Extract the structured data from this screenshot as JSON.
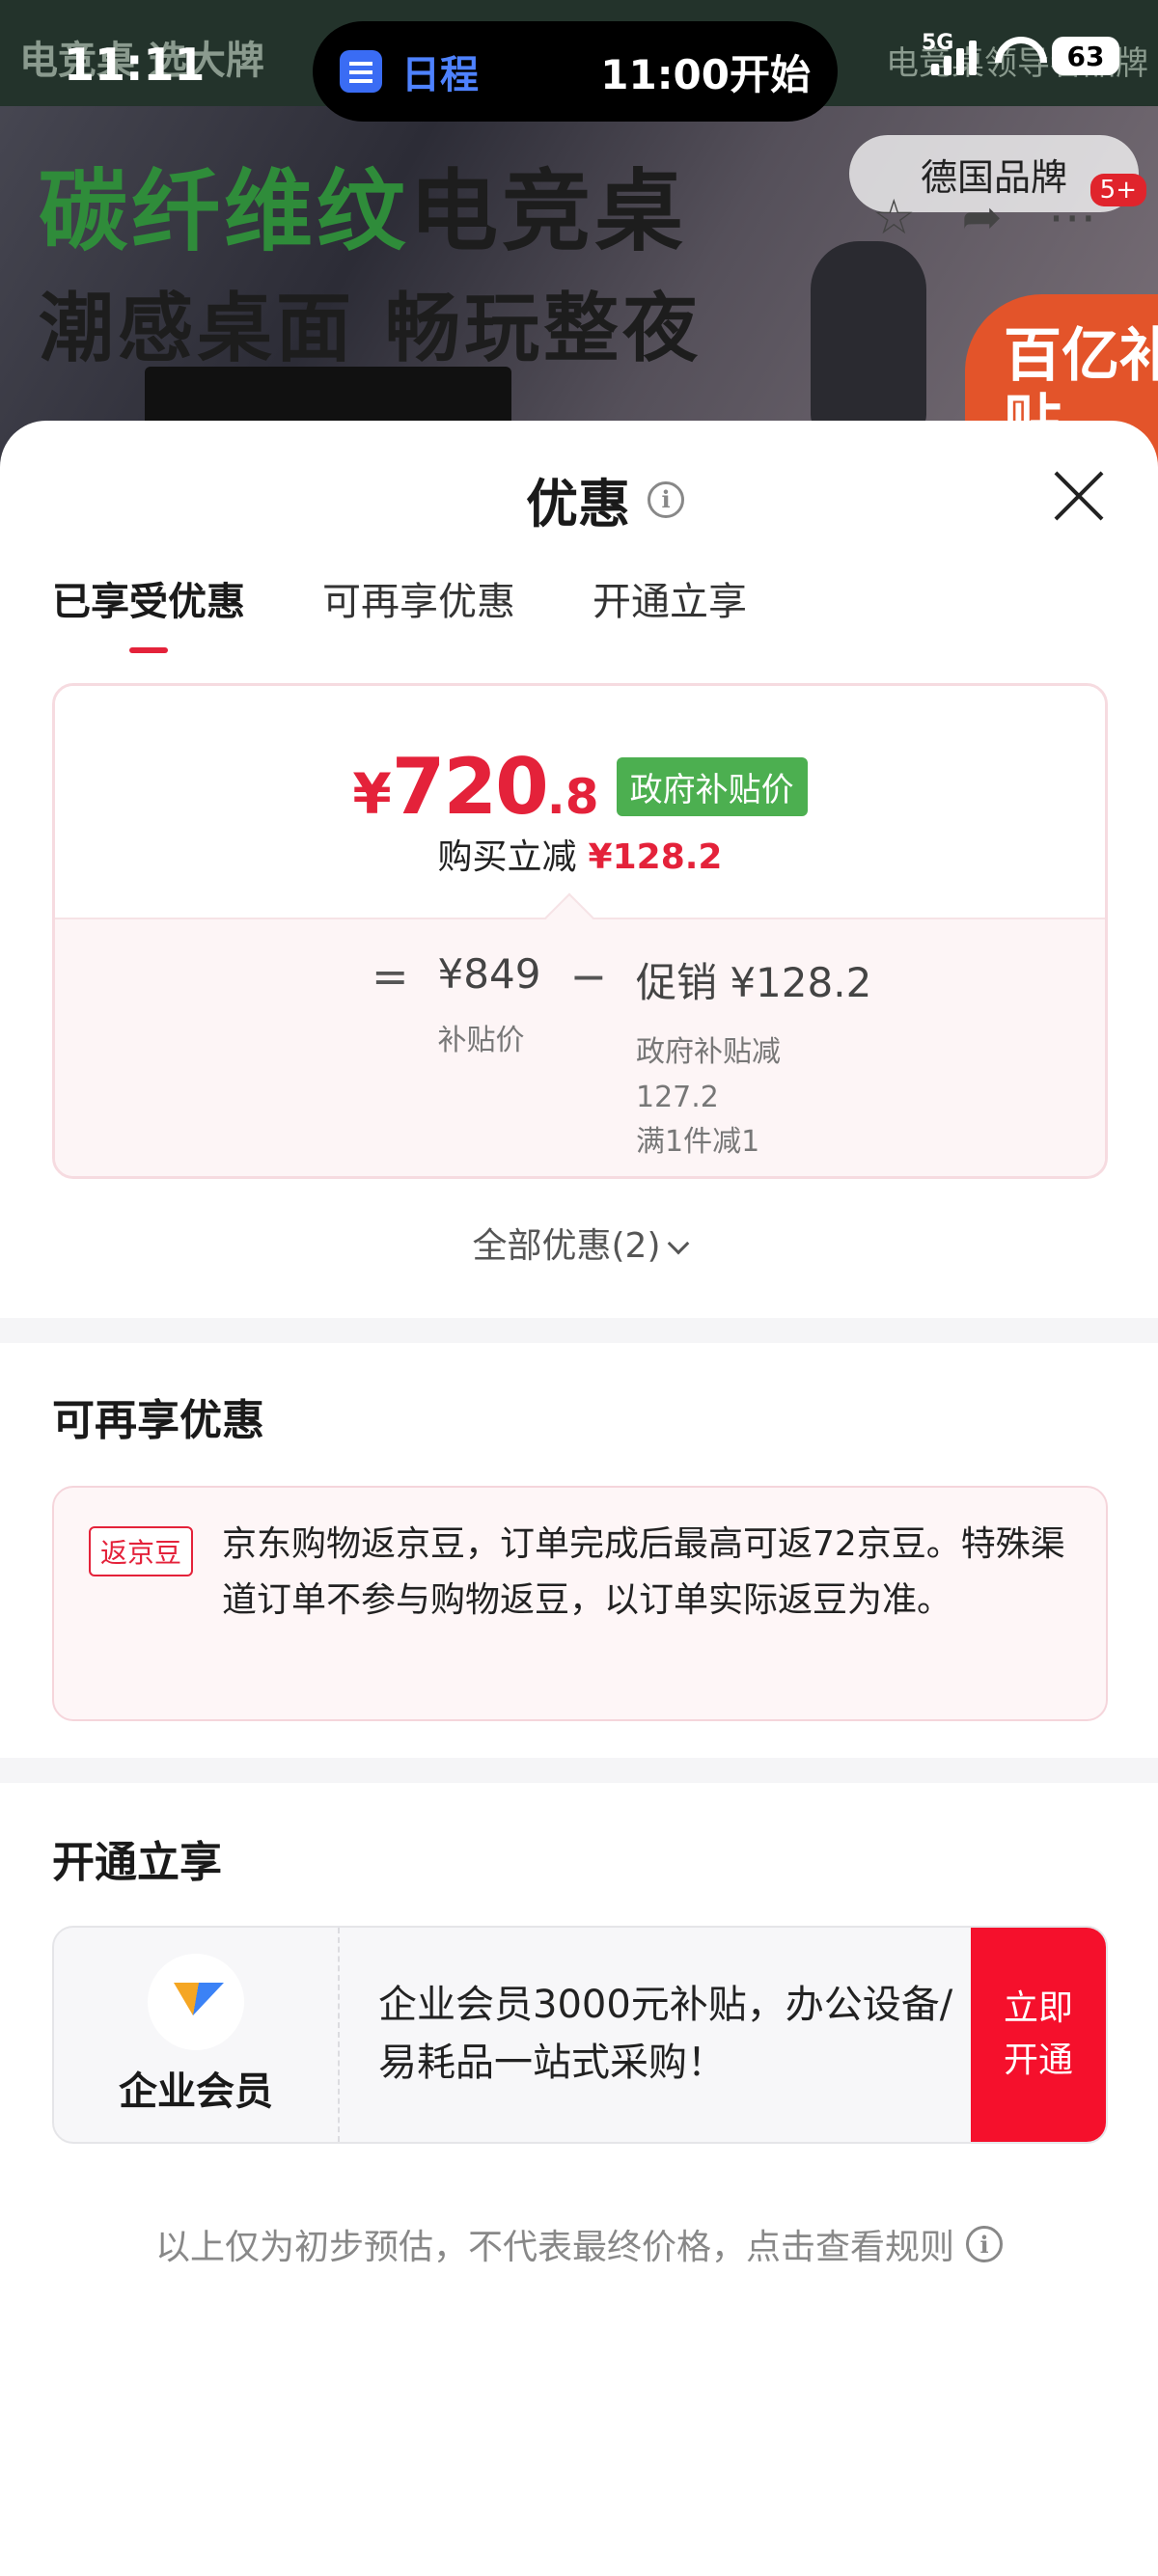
{
  "status_bar": {
    "time": "11:11",
    "island_label": "日程",
    "island_time": "11:00开始",
    "network": "5G",
    "battery": "63"
  },
  "background": {
    "top_left_text": "电竞桌 选大牌",
    "top_right_text": "电竞桌领导者品牌",
    "headline_green": "碳纤维纹",
    "headline_dark": "电竞桌",
    "subline": "潮感桌面 畅玩整夜",
    "brand_chip": "德国品牌",
    "cart_badge": "5+",
    "subsidy_text": "百亿补贴"
  },
  "sheet": {
    "title": "优惠",
    "tabs": [
      {
        "label": "已享受优惠",
        "active": true
      },
      {
        "label": "可再享优惠",
        "active": false
      },
      {
        "label": "开通立享",
        "active": false
      }
    ]
  },
  "price_card": {
    "currency": "¥",
    "price_integer": "720",
    "price_decimal": ".8",
    "tag": "政府补贴价",
    "instant_label": "购买立减",
    "instant_amount": "¥128.2",
    "equals": "=",
    "base_value": "¥849",
    "base_label": "补贴价",
    "minus": "−",
    "promo_value": "促销 ¥128.2",
    "promo_label_1": "政府补贴减",
    "promo_label_2": "127.2",
    "promo_label_3": "满1件减1"
  },
  "all_deals": "全部优惠(2)",
  "more_section": {
    "title": "可再享优惠",
    "tag": "返京豆",
    "text": "京东购物返京豆，订单完成后最高可返72京豆。特殊渠道订单不参与购物返豆，以订单实际返豆为准。"
  },
  "open_section": {
    "title": "开通立享",
    "member_name": "企业会员",
    "member_desc": "企业会员3000元补贴，办公设备/易耗品一站式采购！",
    "button_line1": "立即",
    "button_line2": "开通"
  },
  "footer_note": "以上仅为初步预估，不代表最终价格，点击查看规则",
  "colors": {
    "accent_red": "#e4223a",
    "gov_green": "#4caf50",
    "button_red": "#f5102c"
  }
}
